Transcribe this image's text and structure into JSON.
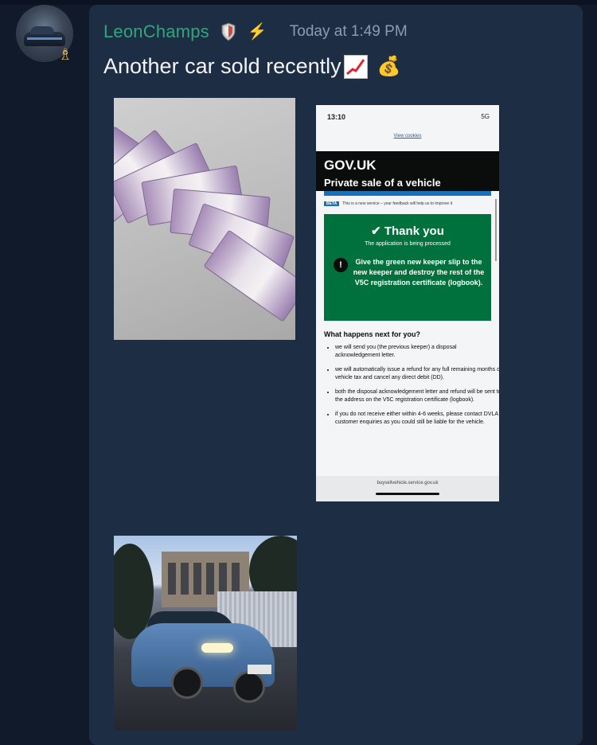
{
  "message": {
    "username": "LeonChamps",
    "role_badge_icon": "shield-role-icon",
    "bolt_icon": "⚡",
    "timestamp": "Today at 1:49 PM",
    "text": "Another car sold recently",
    "emoji_1": "chart-increasing-emoji",
    "emoji_2": "💰",
    "avatar_badge": "♗"
  },
  "phone_screenshot": {
    "status_time": "13:10",
    "status_right": "5G",
    "cookies_link": "View cookies",
    "gov_logo": "GOV.UK",
    "service_title": "Private sale of a vehicle",
    "beta_tag": "BETA",
    "beta_text": "This is a new service – your feedback will help us to improve it",
    "panel_title": "✔ Thank you",
    "panel_sub": "The application is being processed",
    "warning_text": "Give the green new keeper slip to the new keeper and destroy the rest of the V5C registration certificate (logbook).",
    "next_heading": "What happens next for you?",
    "bullets": [
      "we will send you (the previous keeper) a disposal acknowledgement letter.",
      "we will automatically issue a refund for any full remaining months of vehicle tax and cancel any direct debit (DD).",
      "both the disposal acknowledgement letter and refund will be sent to the address on the V5C registration certificate (logbook).",
      "if you do not receive either within 4-6 weeks, please contact DVLA customer enquiries as you could still be liable for the vehicle."
    ],
    "footer_url": "buysellvehicle.service.gov.uk"
  },
  "colors": {
    "username": "#2fa77c",
    "background": "#111a2a",
    "message_bg": "#1d2d44",
    "gov_green": "#00703c"
  }
}
